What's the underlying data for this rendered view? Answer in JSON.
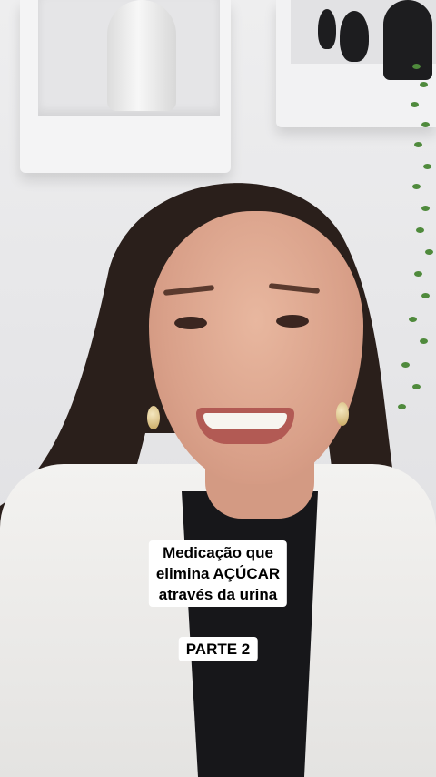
{
  "caption": {
    "lines": [
      "Medicação que",
      "elimina AÇÚCAR",
      "através da urina"
    ],
    "part": "PARTE 2"
  },
  "colors": {
    "caption_background": "#ffffff",
    "caption_text": "#000000",
    "jacket": "#f1f0ee",
    "shirt": "#17171a",
    "hair": "#2a1f1b",
    "wall": "#e9e9ea"
  }
}
